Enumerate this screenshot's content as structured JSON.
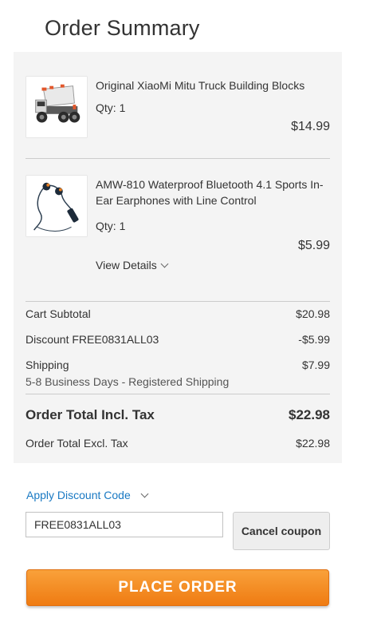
{
  "page": {
    "title": "Order Summary"
  },
  "items": [
    {
      "name": "Original XiaoMi Mitu Truck Building Blocks",
      "qty_label": "Qty:",
      "qty": "1",
      "price": "$14.99",
      "image_icon": "truck-toy-image"
    },
    {
      "name": "AMW-810 Waterproof Bluetooth 4.1 Sports In-Ear Earphones with Line Control",
      "qty_label": "Qty:",
      "qty": "1",
      "price": "$5.99",
      "image_icon": "earphones-image",
      "view_details": "View Details"
    }
  ],
  "totals": {
    "subtotal_label": "Cart Subtotal",
    "subtotal": "$20.98",
    "discount_label": "Discount FREE0831ALL03",
    "discount": "-$5.99",
    "shipping_label": "Shipping",
    "shipping": "$7.99",
    "shipping_method": "5-8 Business Days - Registered Shipping",
    "total_incl_label": "Order Total Incl. Tax",
    "total_incl": "$22.98",
    "total_excl_label": "Order Total Excl. Tax",
    "total_excl": "$22.98"
  },
  "discount": {
    "toggle_label": "Apply Discount Code",
    "code_value": "FREE0831ALL03",
    "cancel_label": "Cancel coupon"
  },
  "actions": {
    "place_order": "PLACE ORDER"
  },
  "colors": {
    "accent": "#1979c3",
    "button_orange": "#f28c1e",
    "panel_bg": "#f4f4f4"
  }
}
